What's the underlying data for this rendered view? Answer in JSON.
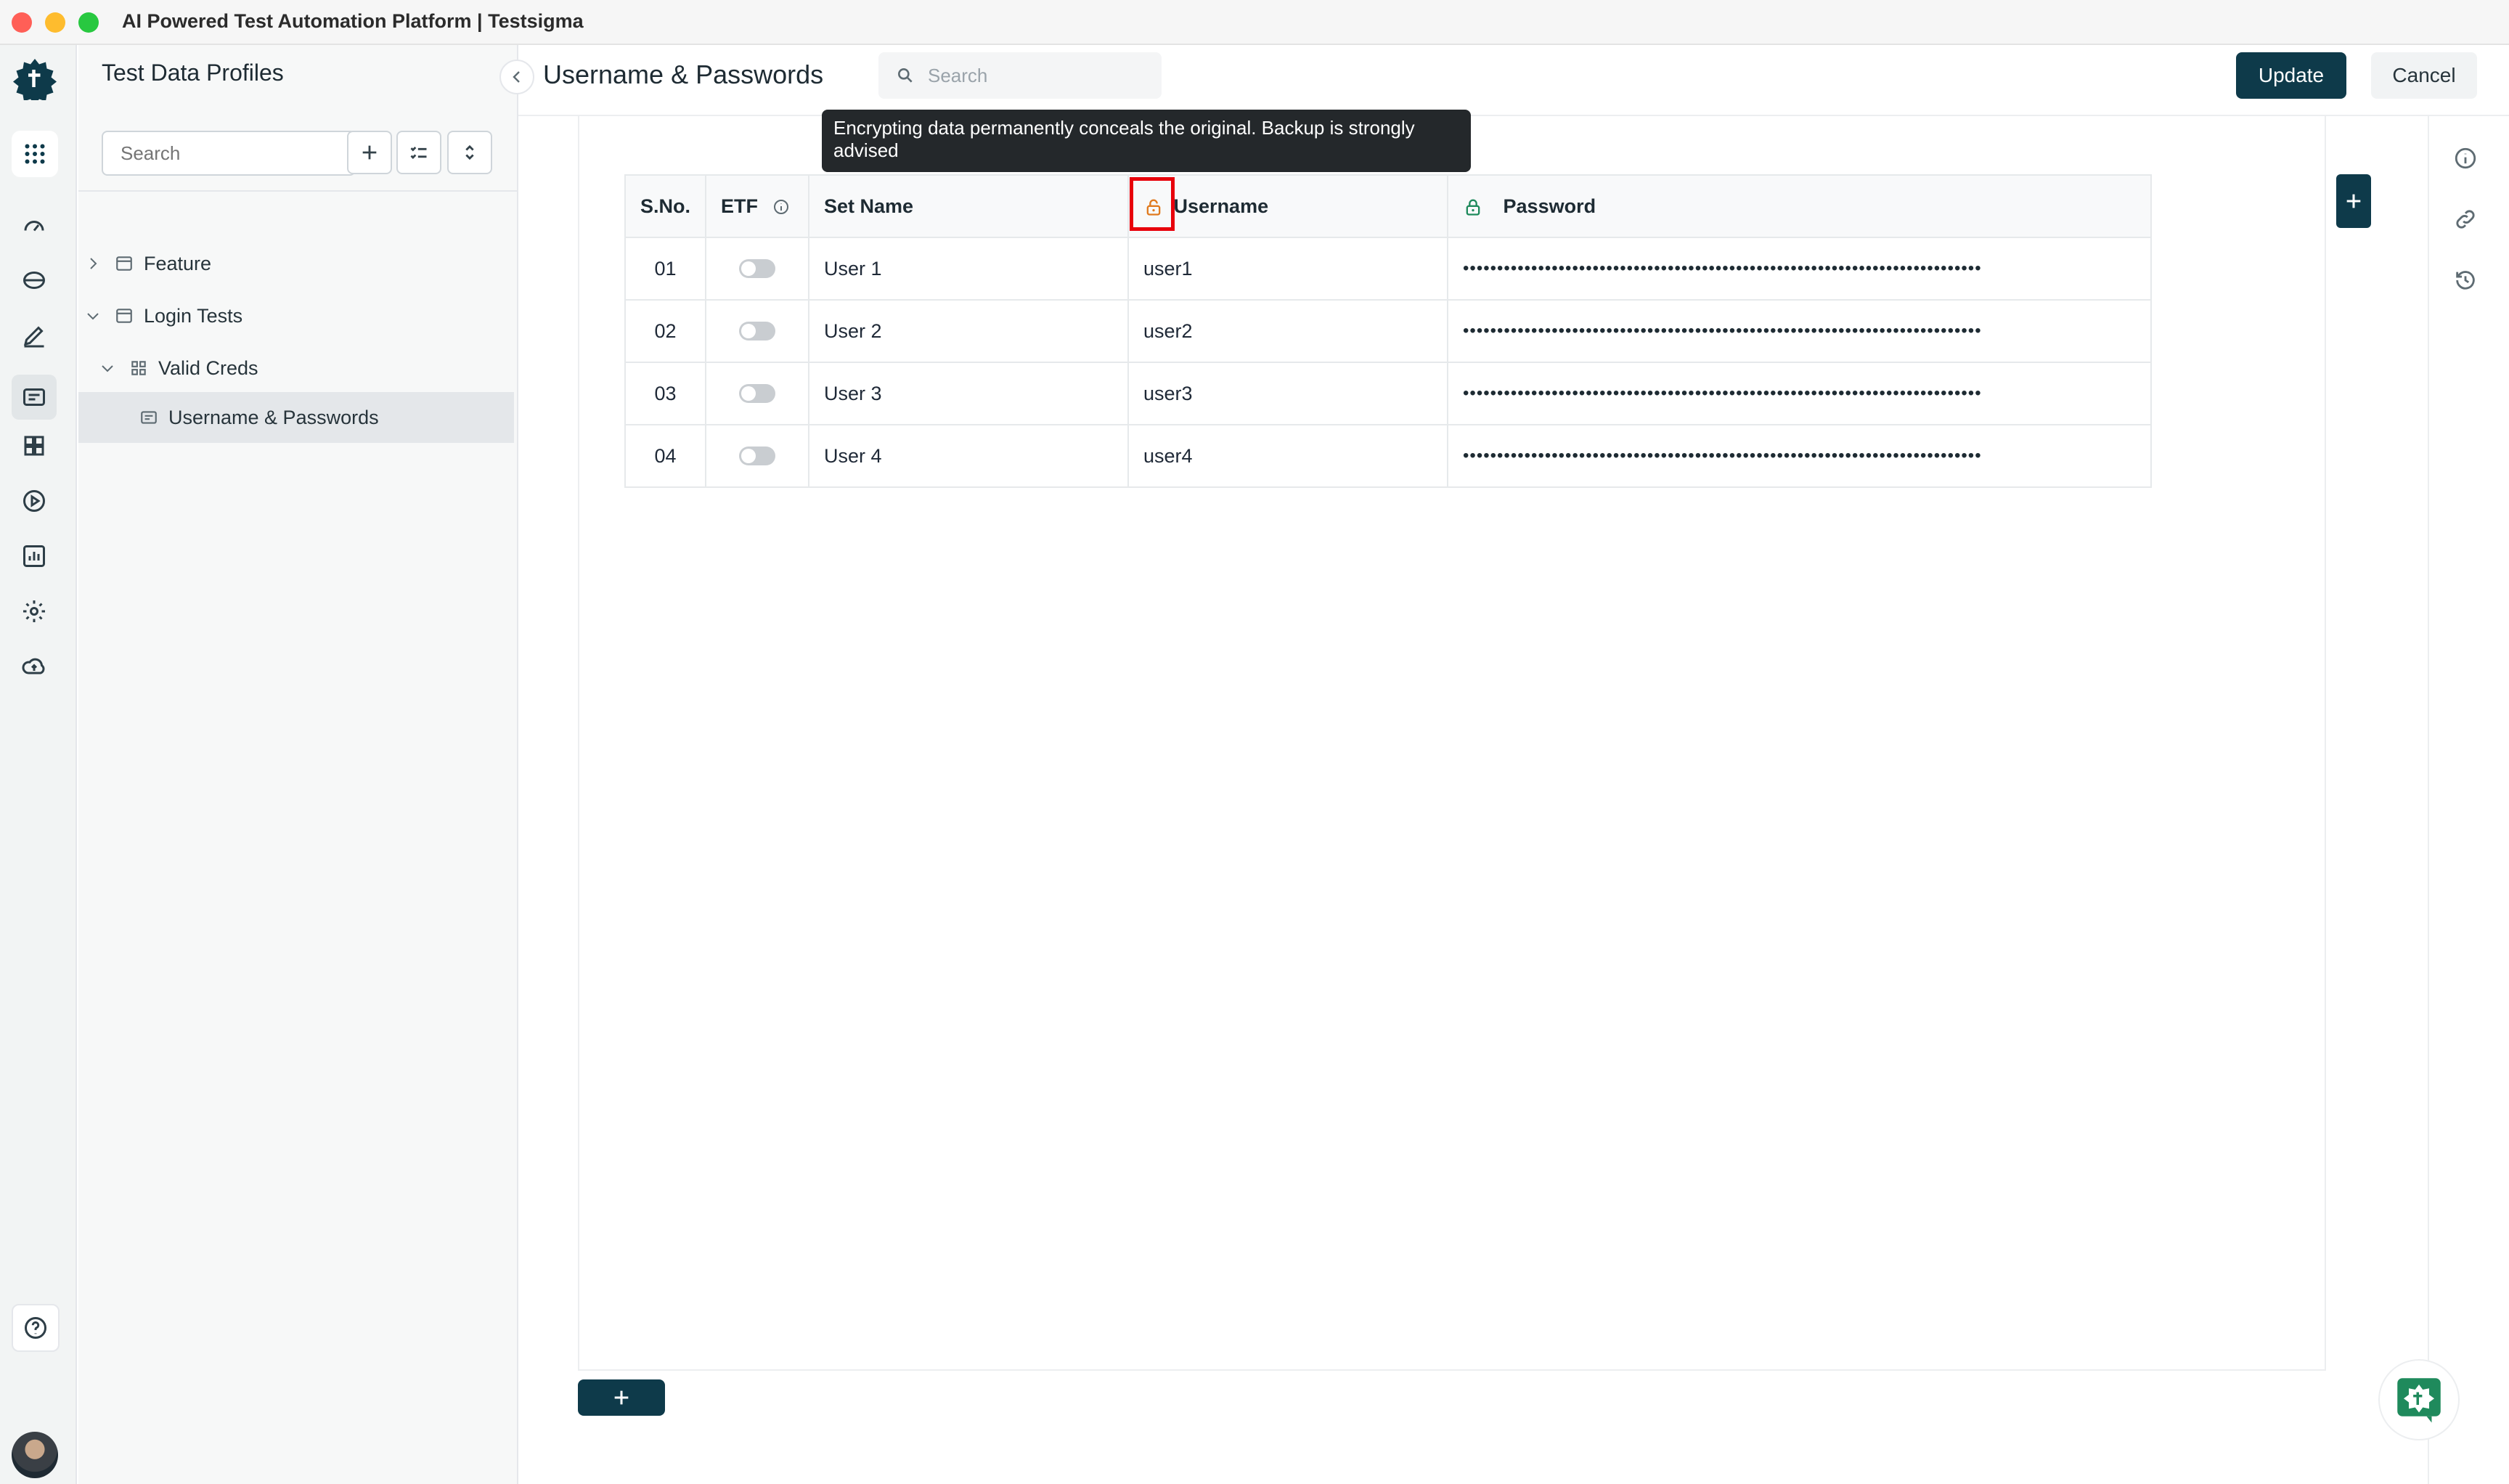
{
  "window": {
    "title": "AI Powered Test Automation Platform | Testsigma"
  },
  "sidebar": {
    "title": "Test Data Profiles",
    "search_placeholder": "Search",
    "tree": [
      {
        "label": "Feature"
      },
      {
        "label": "Login Tests"
      },
      {
        "label": "Valid Creds"
      },
      {
        "label": "Username & Passwords"
      }
    ]
  },
  "header": {
    "title": "Username & Passwords",
    "search_placeholder": "Search",
    "update_label": "Update",
    "cancel_label": "Cancel"
  },
  "tooltip": {
    "text": "Encrypting data permanently conceals the original. Backup is strongly advised"
  },
  "table": {
    "columns": {
      "sno": "S.No.",
      "etf": "ETF",
      "set_name": "Set Name",
      "username": "Username",
      "password": "Password"
    },
    "rows": [
      {
        "sno": "01",
        "set_name": "User 1",
        "username": "user1",
        "password": "••••••••••••••••••••••••••••••••••••••••••••••••••••••••••••••••••••••••••••"
      },
      {
        "sno": "02",
        "set_name": "User 2",
        "username": "user2",
        "password": "••••••••••••••••••••••••••••••••••••••••••••••••••••••••••••••••••••••••••••"
      },
      {
        "sno": "03",
        "set_name": "User 3",
        "username": "user3",
        "password": "••••••••••••••••••••••••••••••••••••••••••••••••••••••••••••••••••••••••••••"
      },
      {
        "sno": "04",
        "set_name": "User 4",
        "username": "user4",
        "password": "••••••••••••••••••••••••••••••••••••••••••••••••••••••••••••••••••••••••••••"
      }
    ]
  },
  "colors": {
    "brand": "#0e3a4a",
    "unlocked_icon": "#e07a1f",
    "locked_icon": "#1f8a5c",
    "highlight": "#e8000b"
  }
}
